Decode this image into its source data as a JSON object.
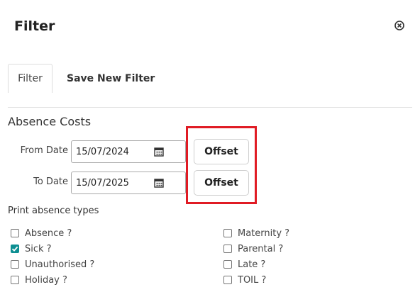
{
  "modal": {
    "title": "Filter",
    "close_icon": "close-circle-icon"
  },
  "tabs": [
    {
      "label": "Filter",
      "active": true
    },
    {
      "label": "Save New Filter",
      "active": false
    }
  ],
  "section": {
    "title": "Absence Costs"
  },
  "from_date": {
    "label": "From Date",
    "value": "15/07/2024",
    "icon": "calendar-icon",
    "offset_label": "Offset"
  },
  "to_date": {
    "label": "To Date",
    "value": "15/07/2025",
    "icon": "calendar-icon",
    "offset_label": "Offset"
  },
  "print_types": {
    "label": "Print absence types",
    "left": [
      {
        "label": "Absence ?",
        "checked": false
      },
      {
        "label": "Sick ?",
        "checked": true
      },
      {
        "label": "Unauthorised ?",
        "checked": false
      },
      {
        "label": "Holiday ?",
        "checked": false
      }
    ],
    "right": [
      {
        "label": "Maternity ?",
        "checked": false
      },
      {
        "label": "Parental ?",
        "checked": false
      },
      {
        "label": "Late ?",
        "checked": false
      },
      {
        "label": "TOIL ?",
        "checked": false
      }
    ]
  },
  "colors": {
    "accent": "#0d8f92",
    "highlight": "#e01b24"
  }
}
